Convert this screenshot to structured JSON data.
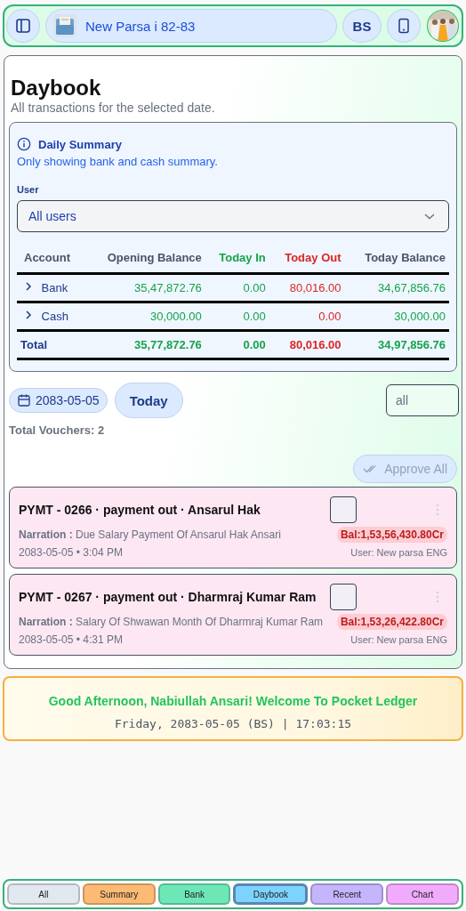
{
  "header": {
    "company": "New Parsa i 82-83",
    "calendar": "BS"
  },
  "page": {
    "title": "Daybook",
    "subtitle": "All transactions for the selected date."
  },
  "summary": {
    "title": "Daily Summary",
    "note": "Only showing bank and cash summary.",
    "user_label": "User",
    "user_value": "All users",
    "columns": [
      "Account",
      "Opening Balance",
      "Today In",
      "Today Out",
      "Today Balance"
    ],
    "rows": [
      {
        "account": "Bank",
        "opening": "35,47,872.76",
        "in": "0.00",
        "out": "80,016.00",
        "balance": "34,67,856.76",
        "expanded": false
      },
      {
        "account": "Cash",
        "opening": "30,000.00",
        "in": "0.00",
        "out": "0.00",
        "balance": "30,000.00",
        "expanded": false
      }
    ],
    "total": {
      "account": "Total",
      "opening": "35,77,872.76",
      "in": "0.00",
      "out": "80,016.00",
      "balance": "34,97,856.76"
    }
  },
  "date": "2083-05-05",
  "today_button": "Today",
  "filter_value": "all",
  "total_vouchers": "Total Vouchers: 2",
  "approve_all": "Approve All",
  "vouchers": [
    {
      "title": "PYMT - 0266 · payment out · Ansarul Hak",
      "narration_label": "Narration :",
      "narration": "Due Salary Payment Of Ansarul Hak Ansari",
      "time": "2083-05-05 • 3:04 PM",
      "balance": "Bal:1,53,56,430.80Cr",
      "user": "User: New parsa ENG",
      "checked": false
    },
    {
      "title": "PYMT - 0267 · payment out · Dharmraj Kumar Ram",
      "narration_label": "Narration :",
      "narration": "Salary Of Shwawan Month Of Dharmraj Kumar Ram",
      "time": "2083-05-05 • 4:31 PM",
      "balance": "Bal:1,53,26,422.80Cr",
      "user": "User: New parsa ENG",
      "checked": false
    }
  ],
  "greeting": {
    "message": "Good Afternoon, Nabiullah Ansari! Welcome To Pocket Ledger",
    "datetime": "Friday, 2083-05-05 (BS) | 17:03:15"
  },
  "tabs": [
    {
      "label": "All",
      "color": "#e2e8f0",
      "selected": false
    },
    {
      "label": "Summary",
      "color": "#fdba74",
      "selected": false
    },
    {
      "label": "Bank",
      "color": "#6ee7b7",
      "selected": false
    },
    {
      "label": "Daybook",
      "color": "#7dd3fc",
      "selected": true
    },
    {
      "label": "Recent",
      "color": "#c4b5fd",
      "selected": false
    },
    {
      "label": "Chart",
      "color": "#f0abfc",
      "selected": false
    }
  ]
}
